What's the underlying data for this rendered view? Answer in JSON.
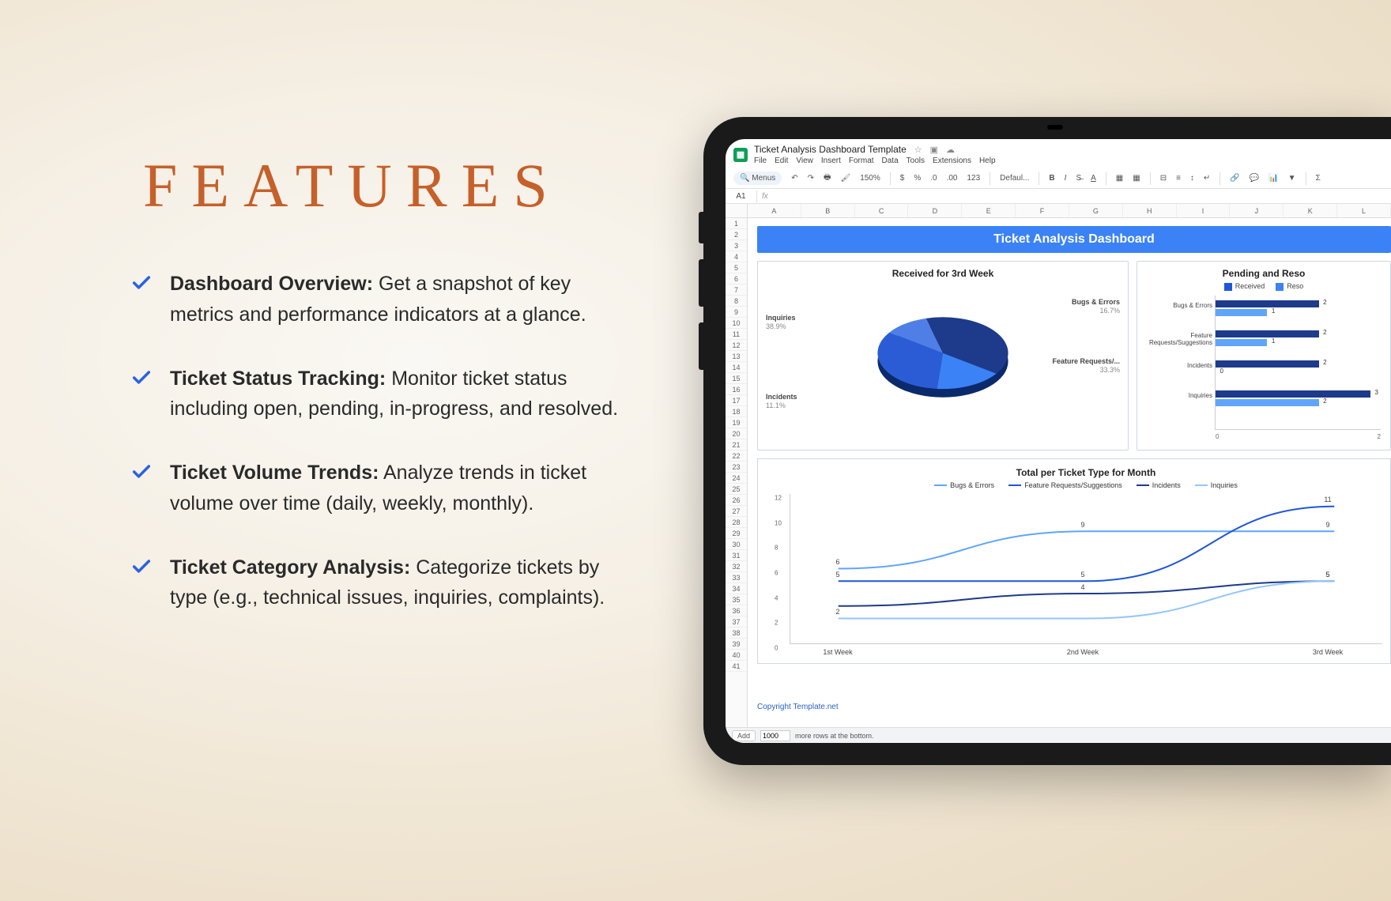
{
  "heading": "FEATURES",
  "features": [
    {
      "title": "Dashboard Overview:",
      "desc": " Get a snapshot of key metrics and performance indicators at a glance."
    },
    {
      "title": "Ticket Status Tracking:",
      "desc": " Monitor ticket status including open, pending, in-progress, and resolved."
    },
    {
      "title": "Ticket Volume Trends:",
      "desc": " Analyze trends in ticket volume over time (daily, weekly, monthly)."
    },
    {
      "title": "Ticket Category Analysis:",
      "desc": " Categorize tickets by type (e.g., technical issues, inquiries, complaints)."
    }
  ],
  "sheets": {
    "doc_title": "Ticket Analysis Dashboard Template",
    "menu": [
      "File",
      "Edit",
      "View",
      "Insert",
      "Format",
      "Data",
      "Tools",
      "Extensions",
      "Help"
    ],
    "toolbar": {
      "search_ph": "Menus",
      "zoom": "150%",
      "font": "Defaul..."
    },
    "name_box": "A1",
    "columns": [
      "A",
      "B",
      "C",
      "D",
      "E",
      "F",
      "G",
      "H",
      "I",
      "J",
      "K",
      "L"
    ],
    "rows_count": 41,
    "dashboard_title": "Ticket Analysis Dashboard",
    "copyright": "Copyright Template.net",
    "footer": {
      "add": "Add",
      "rows_default": "1000",
      "more": "more rows at the bottom."
    }
  },
  "chart_data": [
    {
      "type": "pie",
      "title": "Received for 3rd Week",
      "categories": [
        "Inquiries",
        "Bugs & Errors",
        "Feature Requests/...",
        "Incidents"
      ],
      "values": [
        38.9,
        16.7,
        33.3,
        11.1
      ],
      "colors": [
        "#1e3a8a",
        "#3b82f6",
        "#2b5cd6",
        "#4f7fe6"
      ],
      "label_units": "%"
    },
    {
      "type": "bar",
      "orientation": "horizontal",
      "title": "Pending and Reso",
      "categories": [
        "Bugs & Errors",
        "Feature Requests/Suggestions",
        "Incidents",
        "Inquiries"
      ],
      "series": [
        {
          "name": "Received",
          "color": "#1e3a8a",
          "values": [
            2,
            2,
            2,
            3
          ]
        },
        {
          "name": "Resolved",
          "color": "#60a5fa",
          "values": [
            1,
            1,
            0,
            2
          ]
        }
      ],
      "x_ticks": [
        0,
        2
      ],
      "legend_labels": [
        "Received",
        "Reso"
      ]
    },
    {
      "type": "line",
      "title": "Total per Ticket Type for Month",
      "x": [
        "1st Week",
        "2nd Week",
        "3rd Week"
      ],
      "series": [
        {
          "name": "Bugs & Errors",
          "color": "#60a5fa",
          "values": [
            6,
            9,
            9
          ]
        },
        {
          "name": "Feature Requests/Suggestions",
          "color": "#1e56d6",
          "values": [
            5,
            5,
            11
          ]
        },
        {
          "name": "Incidents",
          "color": "#1e3a8a",
          "values": [
            3,
            4,
            5
          ]
        },
        {
          "name": "Inquiries",
          "color": "#93c5fd",
          "values": [
            2,
            2,
            5
          ]
        }
      ],
      "ylim": [
        0,
        12
      ],
      "y_ticks": [
        0,
        2,
        4,
        6,
        8,
        10,
        12
      ]
    }
  ]
}
